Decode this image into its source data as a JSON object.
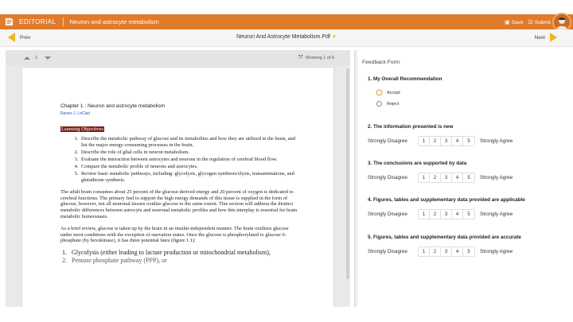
{
  "topbar": {
    "brand": "EDITORIAL",
    "breadcrumb": "Neuron and astrocyte metabolism",
    "save_label": "Save",
    "submit_label": "Submit",
    "accent": "#e07b2c"
  },
  "nav": {
    "prev_label": "Prev",
    "next_label": "Next",
    "file_title": "Neuron And Astrocyte Metabolism.Pdf"
  },
  "viewer": {
    "page_number": "1",
    "showing": "Showing 1 of 6"
  },
  "document": {
    "chapter_title": "Chapter 1 : Neuron and astrocyte metabolism",
    "author": "Renee J. LeClair",
    "objectives_heading": "Learning Objectives",
    "objectives": [
      "Describe the metabolic pathway of glucose and its metabolites and how they are utilized in the brain, and list the major energy-consuming processes in the brain.",
      "Describe the role of glial cells in neuron metabolism.",
      "Evaluate the interaction between astrocytes and neurons in the regulation of cerebral blood flow.",
      "Compare the metabolic profile of neurons and astrocytes.",
      "Review basic metabolic pathways, including: glycolysis, glycogen synthesis/olysis, transaminations, and glutathione synthesis."
    ],
    "paragraph1": "The adult brain consumes about 25 percent of the glucose-derived energy and 20 percent of oxygen is dedicated to cerebral functions. The primary fuel to support the high energy demands of this tissue is supplied in the form of glucose, however, not all neuronal tissues oxidize glucose to the same extent. This section will address the distinct metabolic differences between astrocyte and neuronal metabolic profiles and how this interplay is essential for brain metabolic homeostasis.",
    "paragraph2": "As a brief review, glucose is taken up by the brain in an insulin-independent manner. The brain oxidizes glucose under most conditions with the exception of starvation states. Once the glucose is phosphorylated to glucose 6-phosphate (by hexokinase), it has three potential fates (figure 1.1):",
    "fates": [
      "Glycolysis (either leading to lactate production or mitochondrial metabolism),",
      "Pentose phosphate pathway (PPP), or"
    ]
  },
  "feedback": {
    "title": "Feedback Form",
    "q1": "1.  My Overall Recommendation",
    "q1_options": [
      "Accept",
      "Reject"
    ],
    "q2": "2.  The information presented is new",
    "q3": "3.  The conclusions are supported by data",
    "q4": "4.  Figures, tables and supplementary data provided are applicable",
    "q5": "5.  Figures, tables and supplementary data provided are accurate",
    "scale_low": "Strongly Disagree",
    "scale_high": "Strongly Agree",
    "scale_values": [
      "1",
      "2",
      "3",
      "4",
      "5"
    ]
  }
}
